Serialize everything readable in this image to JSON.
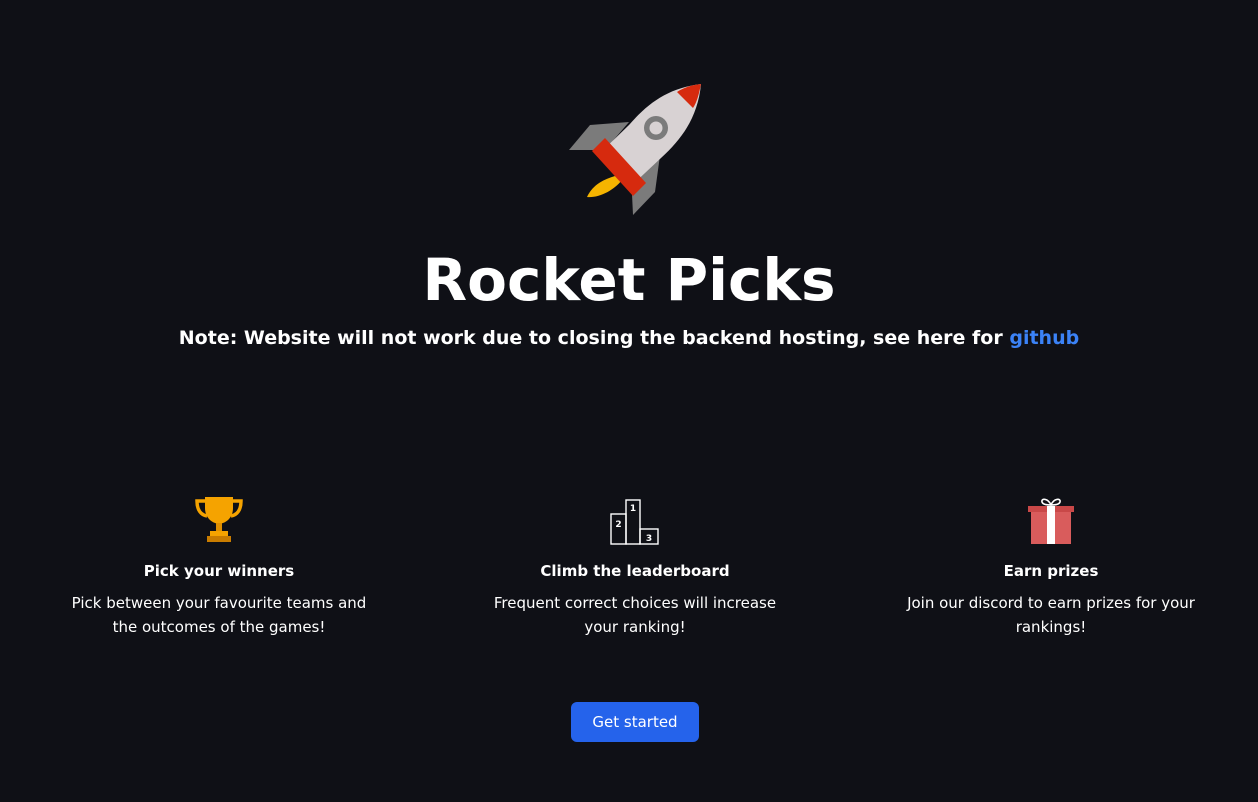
{
  "hero": {
    "logo_icon": "rocket-icon",
    "title": "Rocket Picks",
    "note_text": "Note: Website will not work due to closing the backend hosting, see here for ",
    "note_link": "github"
  },
  "features": [
    {
      "icon": "trophy-icon",
      "title": "Pick your winners",
      "description": "Pick between your favourite teams and the outcomes of the games!"
    },
    {
      "icon": "podium-icon",
      "title": "Climb the leaderboard",
      "description": "Frequent correct choices will increase your ranking!"
    },
    {
      "icon": "gift-icon",
      "title": "Earn prizes",
      "description": "Join our discord to earn prizes for your rankings!"
    }
  ],
  "cta": {
    "label": "Get started"
  },
  "colors": {
    "background": "#0f1016",
    "accent": "#2563eb",
    "link": "#3b82f6"
  }
}
